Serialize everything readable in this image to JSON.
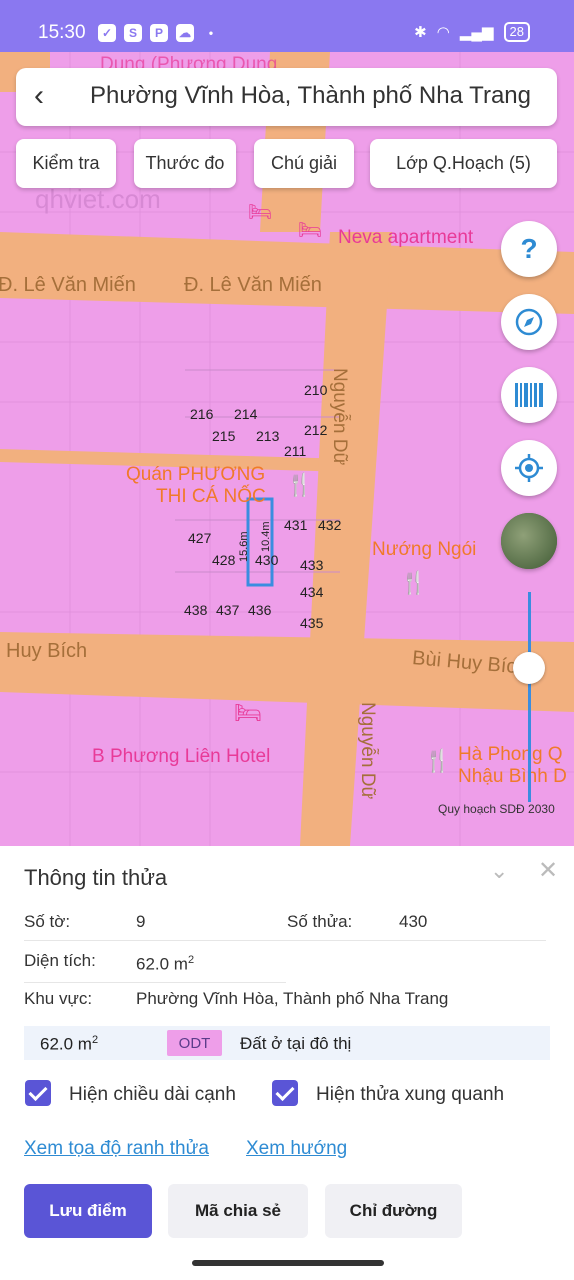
{
  "status": {
    "time": "15:30",
    "battery": "28"
  },
  "header": {
    "title": "Phường Vĩnh Hòa, Thành phố Nha Trang"
  },
  "toolbar": {
    "check": "Kiểm tra",
    "ruler": "Thước đo",
    "legend": "Chú giải",
    "layers": "Lớp Q.Hoạch (5)"
  },
  "map": {
    "help": "?",
    "streets": {
      "le_van_mien_left": "Đ. Lê Văn Miến",
      "le_van_mien_right": "Đ. Lê Văn Miến",
      "nguyen_du_top": "Nguyễn Dữ",
      "nguyen_du_bottom": "Nguyễn Dữ",
      "huy_bich": "Huy Bích",
      "bui_huy_bich": "Bùi Huy Bích"
    },
    "pois": {
      "neva": "Neva apartment",
      "quan_phuong_1": "Quán PHƯƠNG",
      "quan_phuong_2": "THI CÁ NỐC",
      "nuong_ngoi": "Nướng Ngói",
      "hotel": "B Phương Liên Hotel",
      "ha_phong_1": "Hà Phong Q",
      "ha_phong_2": "Nhậu Bình D",
      "top_cut": "Dung (Phương Dung",
      "watermark": "qhviet.com"
    },
    "lots": [
      "210",
      "216",
      "214",
      "215",
      "213",
      "212",
      "211",
      "427",
      "428",
      "431",
      "432",
      "433",
      "434",
      "438",
      "437",
      "436",
      "435",
      "430"
    ],
    "dims": {
      "side1": "15.6m",
      "side2": "10.4m"
    },
    "layer_caption": "Quy hoạch SDĐ 2030",
    "layer_slider": 0.0
  },
  "panel": {
    "title": "Thông tin thửa",
    "to_label": "Số tờ:",
    "to_value": "9",
    "thua_label": "Số thửa:",
    "thua_value": "430",
    "area_label": "Diện tích:",
    "area_value": "62.0 m",
    "area_sup": "2",
    "zone_label": "Khu vực:",
    "zone_value": "Phường Vĩnh Hòa, Thành phố Nha Trang",
    "land_area": "62.0 m",
    "land_sup": "2",
    "land_code": "ODT",
    "land_desc": "Đất ở tại đô thị",
    "check_edges": "Hiện chiều dài cạnh",
    "check_neighbors": "Hiện thửa xung quanh",
    "link_coords": "Xem tọa độ ranh thửa",
    "link_direction": "Xem hướng",
    "btn_save": "Lưu điểm",
    "btn_share": "Mã chia sẻ",
    "btn_route": "Chỉ đường"
  },
  "colors": {
    "primary": "#5a55d6",
    "map_pink": "#ee9ee9",
    "road": "#f2b07f"
  }
}
